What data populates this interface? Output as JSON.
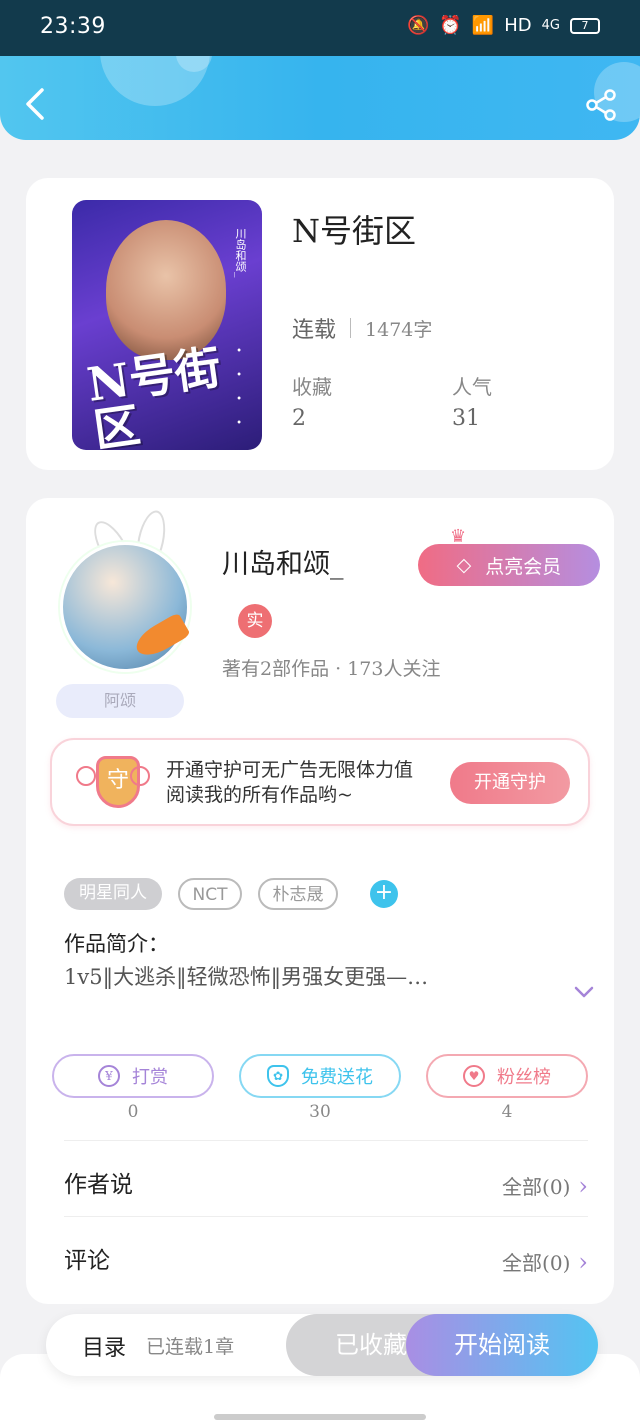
{
  "status_bar": {
    "time": "23:39",
    "network": "HD",
    "signal": "4G",
    "battery": "7"
  },
  "book": {
    "title": "N号街区",
    "state": "连载",
    "word_count": "1474字",
    "favorites_label": "收藏",
    "favorites_value": "2",
    "popularity_label": "人气",
    "popularity_value": "31",
    "cover_text": "N号街区"
  },
  "author": {
    "name": "川岛和颂_",
    "nickname_badge": "阿颂",
    "verified_badge": "实",
    "stats": "著有2部作品 · 173人关注",
    "vip_button": "点亮会员"
  },
  "guard": {
    "shield_char": "守",
    "text": "开通守护可无广告无限体力值阅读我的所有作品哟~",
    "button": "开通守护"
  },
  "tags": [
    "明星同人",
    "NCT",
    "朴志晟"
  ],
  "intro": {
    "heading": "作品简介：",
    "text": "1v5‖大逃杀‖轻微恐怖‖男强女更强—…"
  },
  "actions": [
    {
      "label": "打赏",
      "count": "0",
      "color": "#a584d8"
    },
    {
      "label": "免费送花",
      "count": "30",
      "color": "#3ec3ec"
    },
    {
      "label": "粉丝榜",
      "count": "4",
      "color": "#f07a8a"
    }
  ],
  "sections": [
    {
      "label": "作者说",
      "more": "全部(0)"
    },
    {
      "label": "评论",
      "more": "全部(0)"
    }
  ],
  "bottom_bar": {
    "toc": "目录",
    "chapters": "已连载1章",
    "favorited": "已收藏",
    "start_reading": "开始阅读"
  }
}
